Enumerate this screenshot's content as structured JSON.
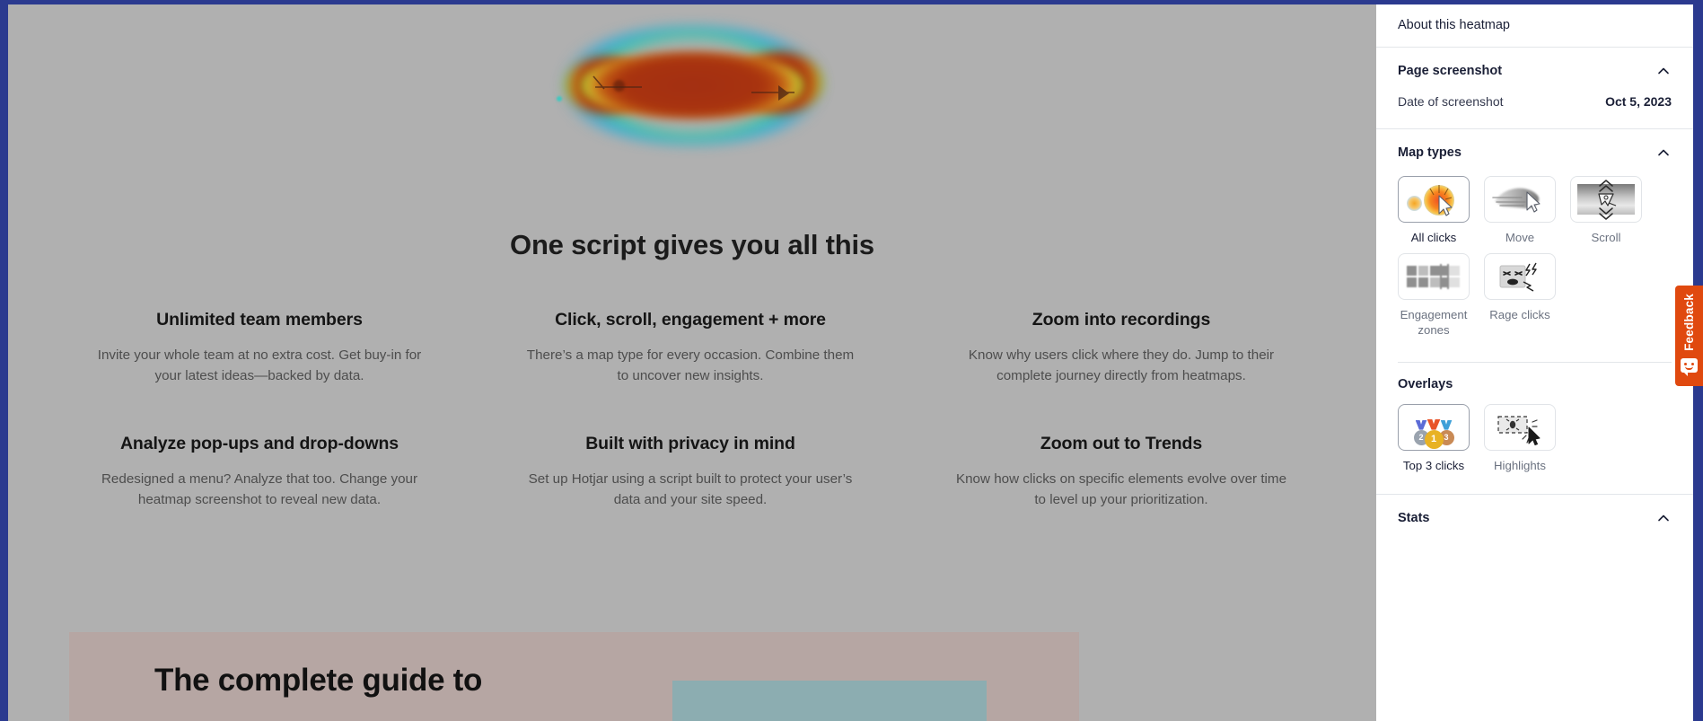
{
  "page": {
    "headline": "One script gives you all this",
    "features": [
      {
        "title": "Unlimited team members",
        "desc": "Invite your whole team at no extra cost. Get buy-in for your latest ideas—backed by data."
      },
      {
        "title": "Click, scroll, engagement + more",
        "desc": "There’s a map type for every occasion. Combine them to uncover new insights."
      },
      {
        "title": "Zoom into recordings",
        "desc": "Know why users click where they do. Jump to their complete journey directly from heatmaps."
      },
      {
        "title": "Analyze pop-ups and drop-downs",
        "desc": "Redesigned a menu? Analyze that too. Change your heatmap screenshot to reveal new data."
      },
      {
        "title": "Built with privacy in mind",
        "desc": "Set up Hotjar using a script built to protect your user’s data and your site speed."
      },
      {
        "title": "Zoom out to Trends",
        "desc": "Know how clicks on specific elements evolve over time to level up your prioritization."
      }
    ],
    "promo": {
      "title": "The complete guide to"
    }
  },
  "sidebar": {
    "about": {
      "title": "About this heatmap"
    },
    "page_screenshot": {
      "title": "Page screenshot",
      "collapse_icon": "chevron-up-icon",
      "date_label": "Date of screenshot",
      "date_value": "Oct 5, 2023"
    },
    "map_types": {
      "title": "Map types",
      "collapse_icon": "chevron-up-icon",
      "tiles": [
        {
          "label": "All clicks",
          "icon": "all-clicks-icon",
          "selected": true
        },
        {
          "label": "Move",
          "icon": "move-icon",
          "selected": false
        },
        {
          "label": "Scroll",
          "icon": "scroll-icon",
          "selected": false
        },
        {
          "label": "Engagement zones",
          "icon": "engagement-zones-icon",
          "selected": false
        },
        {
          "label": "Rage clicks",
          "icon": "rage-clicks-icon",
          "selected": false
        }
      ]
    },
    "overlays": {
      "title": "Overlays",
      "tiles": [
        {
          "label": "Top 3 clicks",
          "icon": "medals-icon",
          "selected": true
        },
        {
          "label": "Highlights",
          "icon": "highlights-icon",
          "selected": false
        }
      ]
    },
    "stats": {
      "title": "Stats",
      "collapse_icon": "chevron-up-icon"
    }
  },
  "feedback": {
    "label": "Feedback",
    "icon": "smiley-chat-icon"
  },
  "medals": [
    {
      "rank": "2",
      "disc": "#9aa3ae",
      "ribbon": "#5b6bd6"
    },
    {
      "rank": "1",
      "disc": "#e8b225",
      "ribbon": "#e8542a"
    },
    {
      "rank": "3",
      "disc": "#c98a55",
      "ribbon": "#3fa0d8"
    }
  ],
  "colors": {
    "frame": "#2b3a8f",
    "page_dim": "#b0b0b0",
    "feedback_orange": "#e0490f",
    "promo_bg": "#b6a6a3",
    "promo_card": "#8cadb1",
    "sidebar_bg": "#ffffff",
    "heading": "#1a1f36",
    "muted": "#6b7280"
  }
}
